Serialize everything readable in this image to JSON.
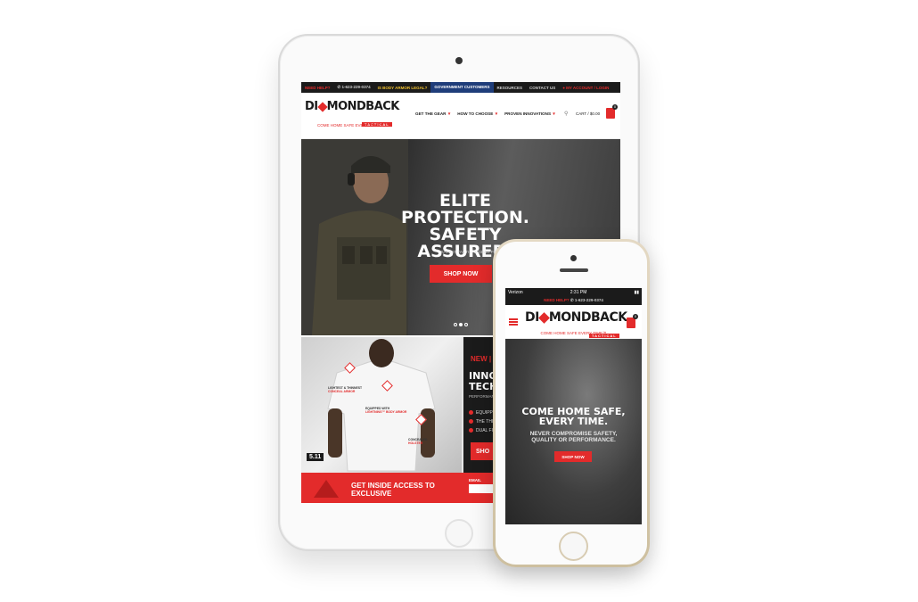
{
  "brand": {
    "logo_pre": "DI",
    "logo_post": "MONDBACK",
    "logo_sub": "TACTICAL",
    "tagline": "COME HOME SAFE EVERY TIME™",
    "accent_color": "#e32b2b"
  },
  "tablet": {
    "topbar": {
      "need_help": "NEED HELP?",
      "phone": "1-623-229-0374",
      "legal": "IS BODY ARMOR LEGAL?",
      "gov": "GOVERNMENT CUSTOMERS",
      "resources": "RESOURCES",
      "contact": "CONTACT US",
      "account": "MY ACCOUNT / LOGIN"
    },
    "nav": [
      {
        "label": "GET THE GEAR"
      },
      {
        "label": "HOW TO CHOOSE"
      },
      {
        "label": "PROVEN INNOVATIONS"
      }
    ],
    "cart": "CART / $0.00",
    "cart_count": "0",
    "hero": {
      "title_line1": "ELITE",
      "title_line2": "PROTECTION.",
      "title_line3": "SAFETY ASSURED.",
      "subtitle": "SAFEST TACTICAL GEAR FOR EVERYDAY PROFI",
      "button": "SHOP NOW"
    },
    "new_section": {
      "tag": "NEW |",
      "title_line1": "INNO",
      "title_line2": "TECHN",
      "perf": "PERFORMAN",
      "bullets": [
        "EQUIPPED",
        "THE THIN",
        "DUAL FIR"
      ],
      "button": "SHO",
      "callouts": {
        "lightest": "LIGHTEST & THINNEST",
        "lightest_red": "CONCEAL ARMOR",
        "equipped": "EQUIPPED WITH",
        "equipped_red": "LIGHTNING™ BODY ARMOR",
        "concealed": "CONCEALED",
        "concealed_red": "HOLSTER"
      },
      "partner": "5.11"
    },
    "signup": {
      "text_line1": "GET INSIDE ACCESS TO",
      "text_line2": "EXCLUSIVE",
      "email_label": "EMAIL"
    }
  },
  "phone": {
    "status": {
      "carrier": "Verizon",
      "time": "2:31 PM"
    },
    "help": {
      "need_help": "NEED HELP?",
      "phone": "1-623-229-0374"
    },
    "cart_count": "0",
    "hero": {
      "title_line1": "COME HOME SAFE,",
      "title_line2": "EVERY TIME.",
      "sub_line1": "NEVER COMPROMISE SAFETY,",
      "sub_line2": "QUALITY OR PERFORMANCE.",
      "button": "SHOP NOW"
    }
  }
}
